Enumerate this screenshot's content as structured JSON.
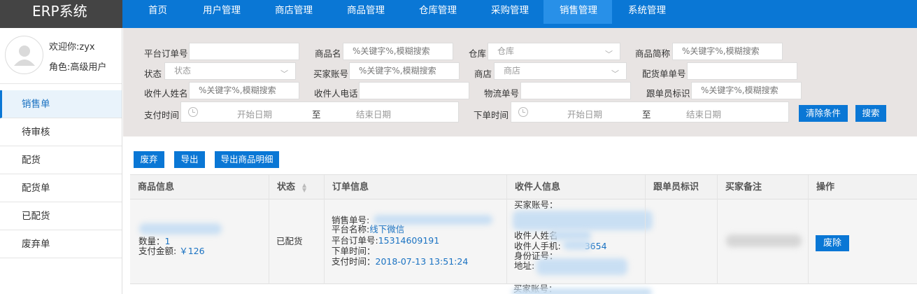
{
  "brand": "ERP系统",
  "nav": [
    "首页",
    "用户管理",
    "商店管理",
    "商品管理",
    "仓库管理",
    "采购管理",
    "销售管理",
    "系统管理"
  ],
  "user": {
    "welcome": "欢迎你:zyx",
    "role": "角色:高级用户"
  },
  "sidebar": [
    "销售单",
    "待审核",
    "配货",
    "配货单",
    "已配货",
    "废弃单"
  ],
  "filters": {
    "platform_order_no": {
      "label": "平台订单号",
      "value": ""
    },
    "product_name": {
      "label": "商品名",
      "placeholder": "%关键字%,模糊搜索"
    },
    "warehouse": {
      "label": "仓库",
      "placeholder": "仓库"
    },
    "product_short": {
      "label": "商品简称",
      "placeholder": "%关键字%,模糊搜索"
    },
    "status": {
      "label": "状态",
      "placeholder": "状态"
    },
    "buyer_account": {
      "label": "买家账号",
      "placeholder": "%关键字%,模糊搜索"
    },
    "store": {
      "label": "商店",
      "placeholder": "商店"
    },
    "dispatch_no": {
      "label": "配货单单号",
      "value": ""
    },
    "receiver_name": {
      "label": "收件人姓名",
      "placeholder": "%关键字%,模糊搜索"
    },
    "receiver_phone": {
      "label": "收件人电话",
      "value": ""
    },
    "logistics_no": {
      "label": "物流单号",
      "value": ""
    },
    "follower_tag": {
      "label": "跟单员标识",
      "placeholder": "%关键字%,模糊搜索"
    },
    "pay_time": {
      "label": "支付时间",
      "start": "开始日期",
      "to": "至",
      "end": "结束日期"
    },
    "order_time": {
      "label": "下单时间",
      "start": "开始日期",
      "to": "至",
      "end": "结束日期"
    },
    "clear_label": "清除条件",
    "search_label": "搜索"
  },
  "actions": [
    "废弃",
    "导出",
    "导出商品明细"
  ],
  "table": {
    "headers": [
      "商品信息",
      "状态",
      "订单信息",
      "收件人信息",
      "跟单员标识",
      "买家备注",
      "操作"
    ],
    "rows": [
      {
        "qty_label": "数量：",
        "qty": "1",
        "amount_label": "支付金额:",
        "amount": "￥126",
        "status": "已配货",
        "order_no_label": "销售单号:",
        "platform_label": "平台名称:",
        "platform": "线下微信",
        "platform_order_label": "平台订单号:",
        "platform_order": "15314609191",
        "order_time_label": "下单时间：",
        "pay_time_label": "支付时间：",
        "pay_time": "2018-07-13 13:51:24",
        "buyer_label": "买家账号：",
        "receiver_label": "收件人姓名",
        "phone_label": "收件人手机:",
        "phone_tail": "3654",
        "id_label": "身份证号：",
        "address_label": "地址:",
        "op_label": "废除"
      }
    ],
    "next_buyer_label": "买家账号："
  }
}
